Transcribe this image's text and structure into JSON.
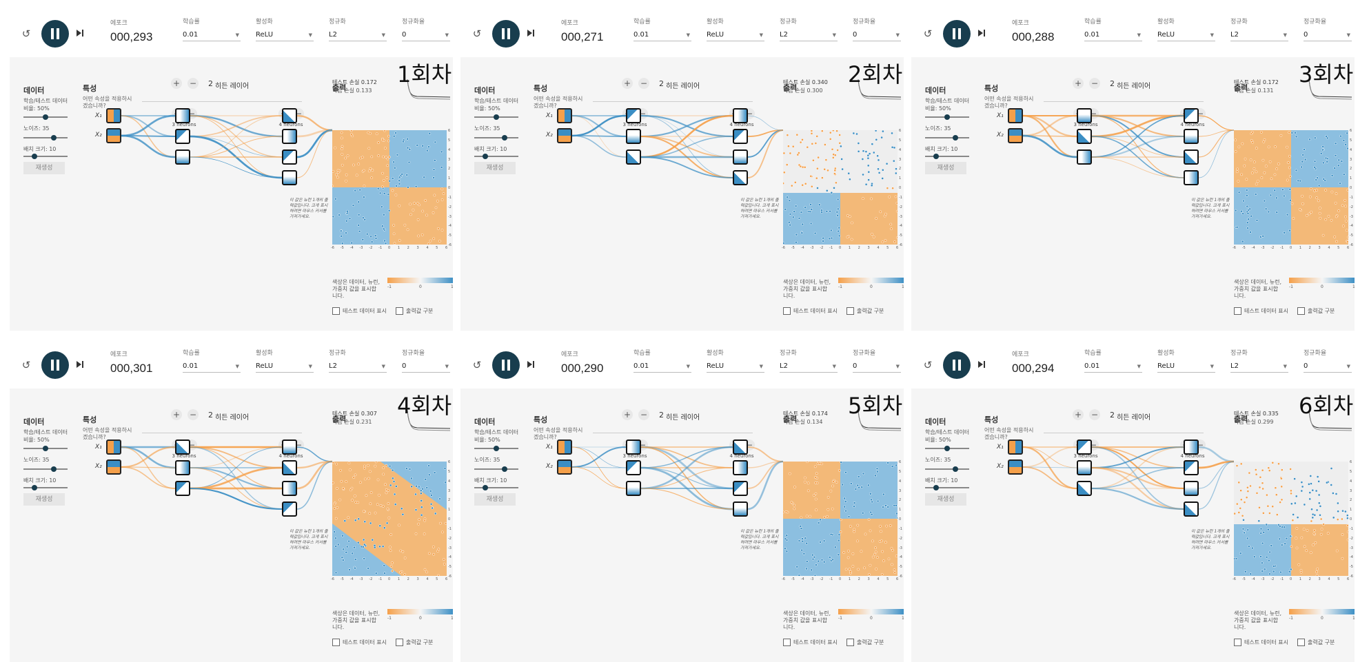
{
  "labels": {
    "epoch": "에포크",
    "learning_rate": "학습률",
    "activation": "활성화",
    "regularization": "정규화",
    "reg_rate": "정규화율",
    "data": "데이터",
    "ratio": "학습/테스트 데이터 비율: 50%",
    "noise": "노이즈: 35",
    "batch": "배치 크기: 10",
    "regenerate": "재생성",
    "features": "특성",
    "features_question": "어떤 속성을 적용하시겠습니까?",
    "hidden_count": "2",
    "hidden_label": "히든 레이어",
    "layer1_neurons": "3 neurons",
    "layer2_neurons": "4 neurons",
    "output": "출력",
    "x1": "X₁",
    "x2": "X₂",
    "note": "이 값은 뉴런 1개의 출력값입니다. 크게 표시하려면 마우스 커서를 가져가세요.",
    "legend_text": "색상은 데이터, 뉴런, 가중치 값을 표시합니다.",
    "legend_ticks": [
      "-1",
      "0",
      "1"
    ],
    "show_test": "테스트 데이터 표시",
    "discretize": "출력값 구분",
    "plus": "+",
    "minus": "−",
    "test_loss_prefix": "테스트 손실 ",
    "train_loss_prefix": "학습 손실 ",
    "axis_ticks": [
      "-6",
      "-5",
      "-4",
      "-3",
      "-2",
      "-1",
      "0",
      "1",
      "2",
      "3",
      "4",
      "5",
      "6"
    ]
  },
  "settings": {
    "learning_rate": "0.01",
    "activation": "ReLU",
    "regularization": "L2",
    "reg_rate": "0"
  },
  "colors": {
    "orange": "#f5a04a",
    "blue": "#3b8ec4",
    "dark": "#183d4e"
  },
  "panels": [
    {
      "round": "1회차",
      "epoch": "000,293",
      "test_loss": "0.172",
      "train_loss": "0.133",
      "pattern": "xor"
    },
    {
      "round": "2회차",
      "epoch": "000,271",
      "test_loss": "0.340",
      "train_loss": "0.300",
      "pattern": "partial"
    },
    {
      "round": "3회차",
      "epoch": "000,288",
      "test_loss": "0.172",
      "train_loss": "0.131",
      "pattern": "xor"
    },
    {
      "round": "4회차",
      "epoch": "000,301",
      "test_loss": "0.307",
      "train_loss": "0.231",
      "pattern": "diagonal"
    },
    {
      "round": "5회차",
      "epoch": "000,290",
      "test_loss": "0.174",
      "train_loss": "0.134",
      "pattern": "xor"
    },
    {
      "round": "6회차",
      "epoch": "000,294",
      "test_loss": "0.335",
      "train_loss": "0.299",
      "pattern": "partial"
    }
  ]
}
